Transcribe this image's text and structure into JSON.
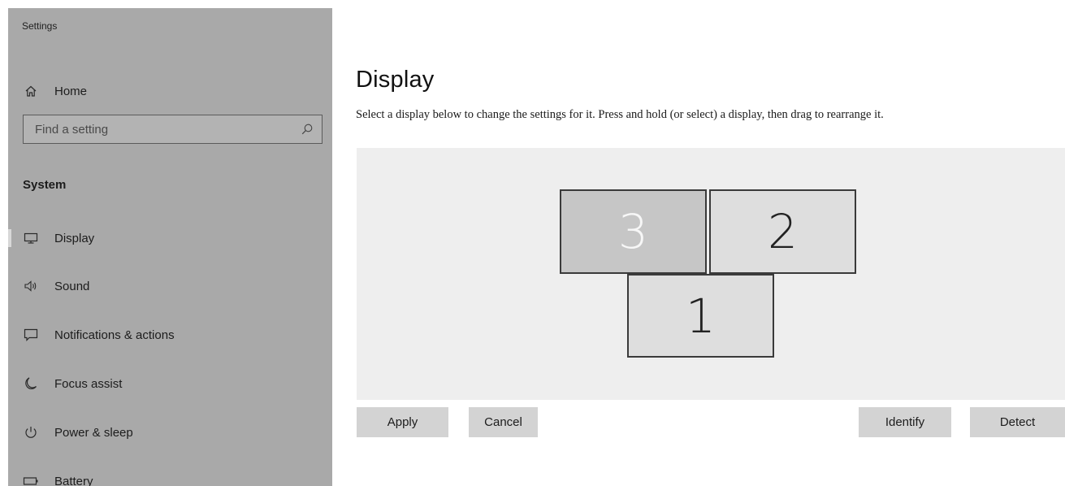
{
  "app": {
    "title": "Settings"
  },
  "sidebar": {
    "search": {
      "placeholder": "Find a setting",
      "icon": "search-icon"
    },
    "section_header": "System",
    "items": [
      {
        "id": "home",
        "label": "Home",
        "icon": "home-icon"
      },
      {
        "id": "display",
        "label": "Display",
        "icon": "monitor-icon",
        "selected": true
      },
      {
        "id": "sound",
        "label": "Sound",
        "icon": "speaker-icon"
      },
      {
        "id": "notifications",
        "label": "Notifications & actions",
        "icon": "message-icon"
      },
      {
        "id": "focus",
        "label": "Focus assist",
        "icon": "moon-icon"
      },
      {
        "id": "power",
        "label": "Power & sleep",
        "icon": "power-icon"
      },
      {
        "id": "battery",
        "label": "Battery",
        "icon": "battery-icon"
      }
    ]
  },
  "main": {
    "title": "Display",
    "subtitle": "Select a display below to change the settings for it. Press and hold (or select) a display, then drag to rearrange it.",
    "monitors": [
      {
        "number": "3",
        "selected": true
      },
      {
        "number": "2",
        "selected": false
      },
      {
        "number": "1",
        "selected": false
      }
    ],
    "buttons": {
      "apply": "Apply",
      "cancel": "Cancel",
      "identify": "Identify",
      "detect": "Detect"
    }
  },
  "colors": {
    "sidebar_bg": "#a9a9a9",
    "arrange_bg": "#eeeeee",
    "button_bg": "#d3d3d3",
    "selected_monitor_bg": "#c6c6c6",
    "monitor_bg": "#dedede"
  }
}
